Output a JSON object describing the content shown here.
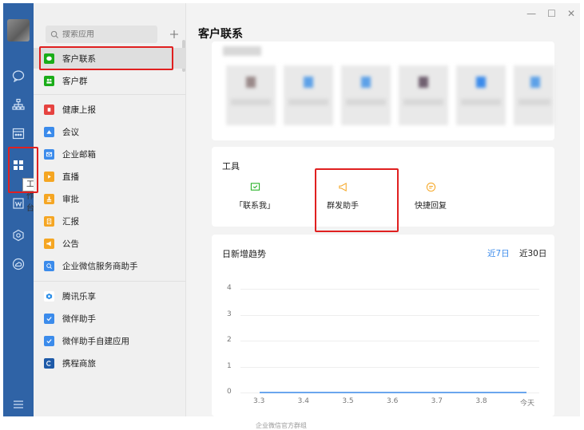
{
  "rail": {
    "tooltip": "工作台",
    "icons": [
      "chat-icon",
      "contacts-icon",
      "calendar-icon",
      "workbench-icon",
      "doc-icon",
      "app-icon",
      "cloud-icon",
      "menu-icon"
    ]
  },
  "apps": {
    "search_placeholder": "搜索应用",
    "add_label": "+",
    "items": [
      {
        "label": "客户联系",
        "color": "#1aad19"
      },
      {
        "label": "客户群",
        "color": "#1aad19"
      },
      {
        "label": "健康上报",
        "color": "#e64340"
      },
      {
        "label": "会议",
        "color": "#3b8beb"
      },
      {
        "label": "企业邮箱",
        "color": "#3b8beb"
      },
      {
        "label": "直播",
        "color": "#f5a623"
      },
      {
        "label": "审批",
        "color": "#f5a623"
      },
      {
        "label": "汇报",
        "color": "#f5a623"
      },
      {
        "label": "公告",
        "color": "#f5a623"
      },
      {
        "label": "企业微信服务商助手",
        "color": "#3b8beb"
      },
      {
        "label": "腾讯乐享",
        "color": "#2b8ee8"
      },
      {
        "label": "微伴助手",
        "color": "#3b8beb"
      },
      {
        "label": "微伴助手自建应用",
        "color": "#3b8beb"
      },
      {
        "label": "携程商旅",
        "color": "#1e5aa8"
      }
    ]
  },
  "main": {
    "title": "客户联系",
    "window_controls": [
      "—",
      "☐",
      "✕"
    ],
    "tools": {
      "title": "工具",
      "items": [
        {
          "label": "「联系我」",
          "color": "#1aad19"
        },
        {
          "label": "群发助手",
          "color": "#f5a623"
        },
        {
          "label": "快捷回复",
          "color": "#f5a623"
        }
      ]
    },
    "trend": {
      "title": "日新增趋势",
      "range_7": "近7日",
      "range_30": "近30日"
    }
  },
  "chart_data": {
    "type": "line",
    "title": "日新增趋势",
    "categories": [
      "3.3",
      "3.4",
      "3.5",
      "3.6",
      "3.7",
      "3.8",
      "今天"
    ],
    "series": [
      {
        "values": [
          0,
          0,
          0,
          0,
          0,
          0,
          0
        ]
      }
    ],
    "yticks": [
      "4",
      "3",
      "2",
      "1",
      "0"
    ],
    "ylim": [
      0,
      4
    ],
    "grid": true,
    "line_color": "#3b8beb"
  },
  "footer": "企业微信官方群组"
}
